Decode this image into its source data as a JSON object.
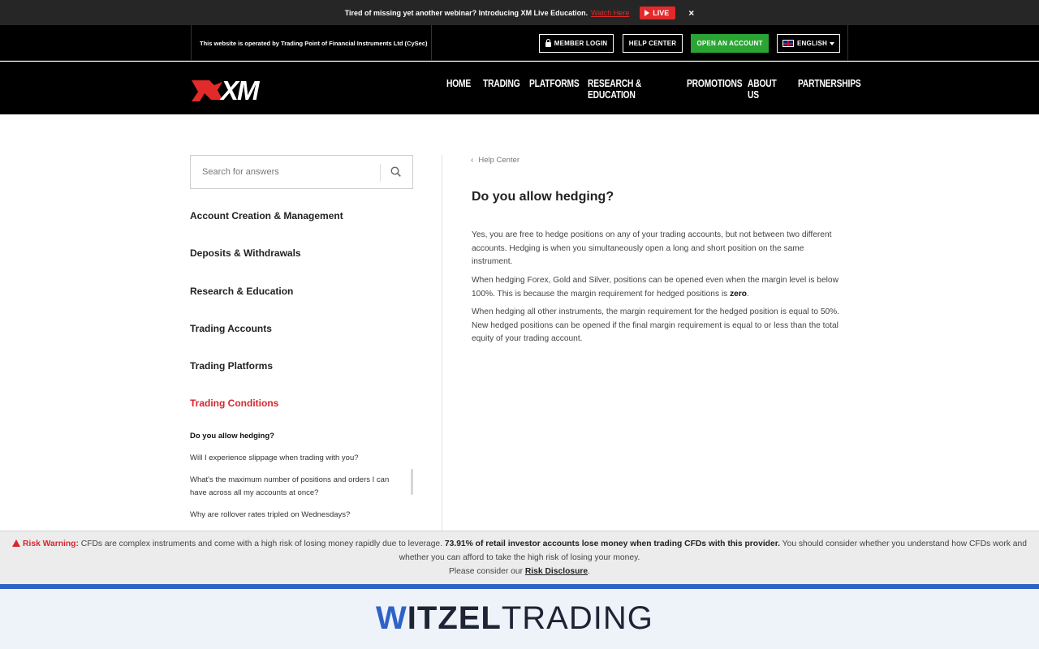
{
  "promo": {
    "text": "Tired of missing yet another webinar? Introducing XM Live Education.",
    "link": "Watch Here",
    "live": "LIVE",
    "close": "×"
  },
  "utility": {
    "operator": "This website is operated by Trading Point of Financial Instruments Ltd (CySec)",
    "member_login": "MEMBER LOGIN",
    "help_center": "HELP CENTER",
    "open_account": "OPEN AN ACCOUNT",
    "language": "ENGLISH"
  },
  "logo": {
    "text": "XM"
  },
  "nav": {
    "items": [
      {
        "label": "HOME"
      },
      {
        "label": "TRADING"
      },
      {
        "label": "PLATFORMS"
      },
      {
        "label": "RESEARCH & EDUCATION"
      },
      {
        "label": "PROMOTIONS"
      },
      {
        "label": "ABOUT US"
      },
      {
        "label": "PARTNERSHIPS"
      }
    ]
  },
  "sidebar": {
    "search_placeholder": "Search for answers",
    "categories": [
      {
        "label": "Account Creation & Management"
      },
      {
        "label": "Deposits & Withdrawals"
      },
      {
        "label": "Research & Education"
      },
      {
        "label": "Trading Accounts"
      },
      {
        "label": "Trading Platforms"
      },
      {
        "label": "Trading Conditions"
      }
    ],
    "questions": [
      {
        "label": "Do you allow hedging?"
      },
      {
        "label": "Will I experience slippage when trading with you?"
      },
      {
        "label": "What's the maximum number of positions and orders I can have across all my accounts at once?"
      },
      {
        "label": "Why are rollover rates tripled on Wednesdays?"
      }
    ]
  },
  "content": {
    "breadcrumb": "Help Center",
    "title": "Do you allow hedging?",
    "p1": "Yes, you are free to hedge positions on any of your trading accounts, but not between two different accounts. Hedging is when you simultaneously open a long and short position on the same instrument.",
    "p2_a": "When hedging Forex, Gold and Silver, positions can be opened even when the margin level is below 100%. This is because the margin requirement for hedged positions is ",
    "p2_b": "zero",
    "p2_c": ".",
    "p3": "When hedging all other instruments, the margin requirement for the hedged position is equal to 50%. New hedged positions can be opened if the final margin requirement is equal to or less than the total equity of your trading account."
  },
  "risk": {
    "label": "Risk Warning:",
    "t1": " CFDs are complex instruments and come with a high risk of losing money rapidly due to leverage. ",
    "bold": "73.91% of retail investor accounts lose money when trading CFDs with this provider.",
    "t2": " You should consider whether you understand how CFDs work and whether you can afford to take the high risk of losing your money.",
    "t3": "Please consider our ",
    "link": "Risk Disclosure",
    "t4": "."
  },
  "brand": {
    "w": "W",
    "itzel": "ITZEL",
    "trading": "TRADING"
  },
  "colors": {
    "accent_red": "#d7262e",
    "green": "#2aa534",
    "brand_blue": "#2f62c7"
  }
}
